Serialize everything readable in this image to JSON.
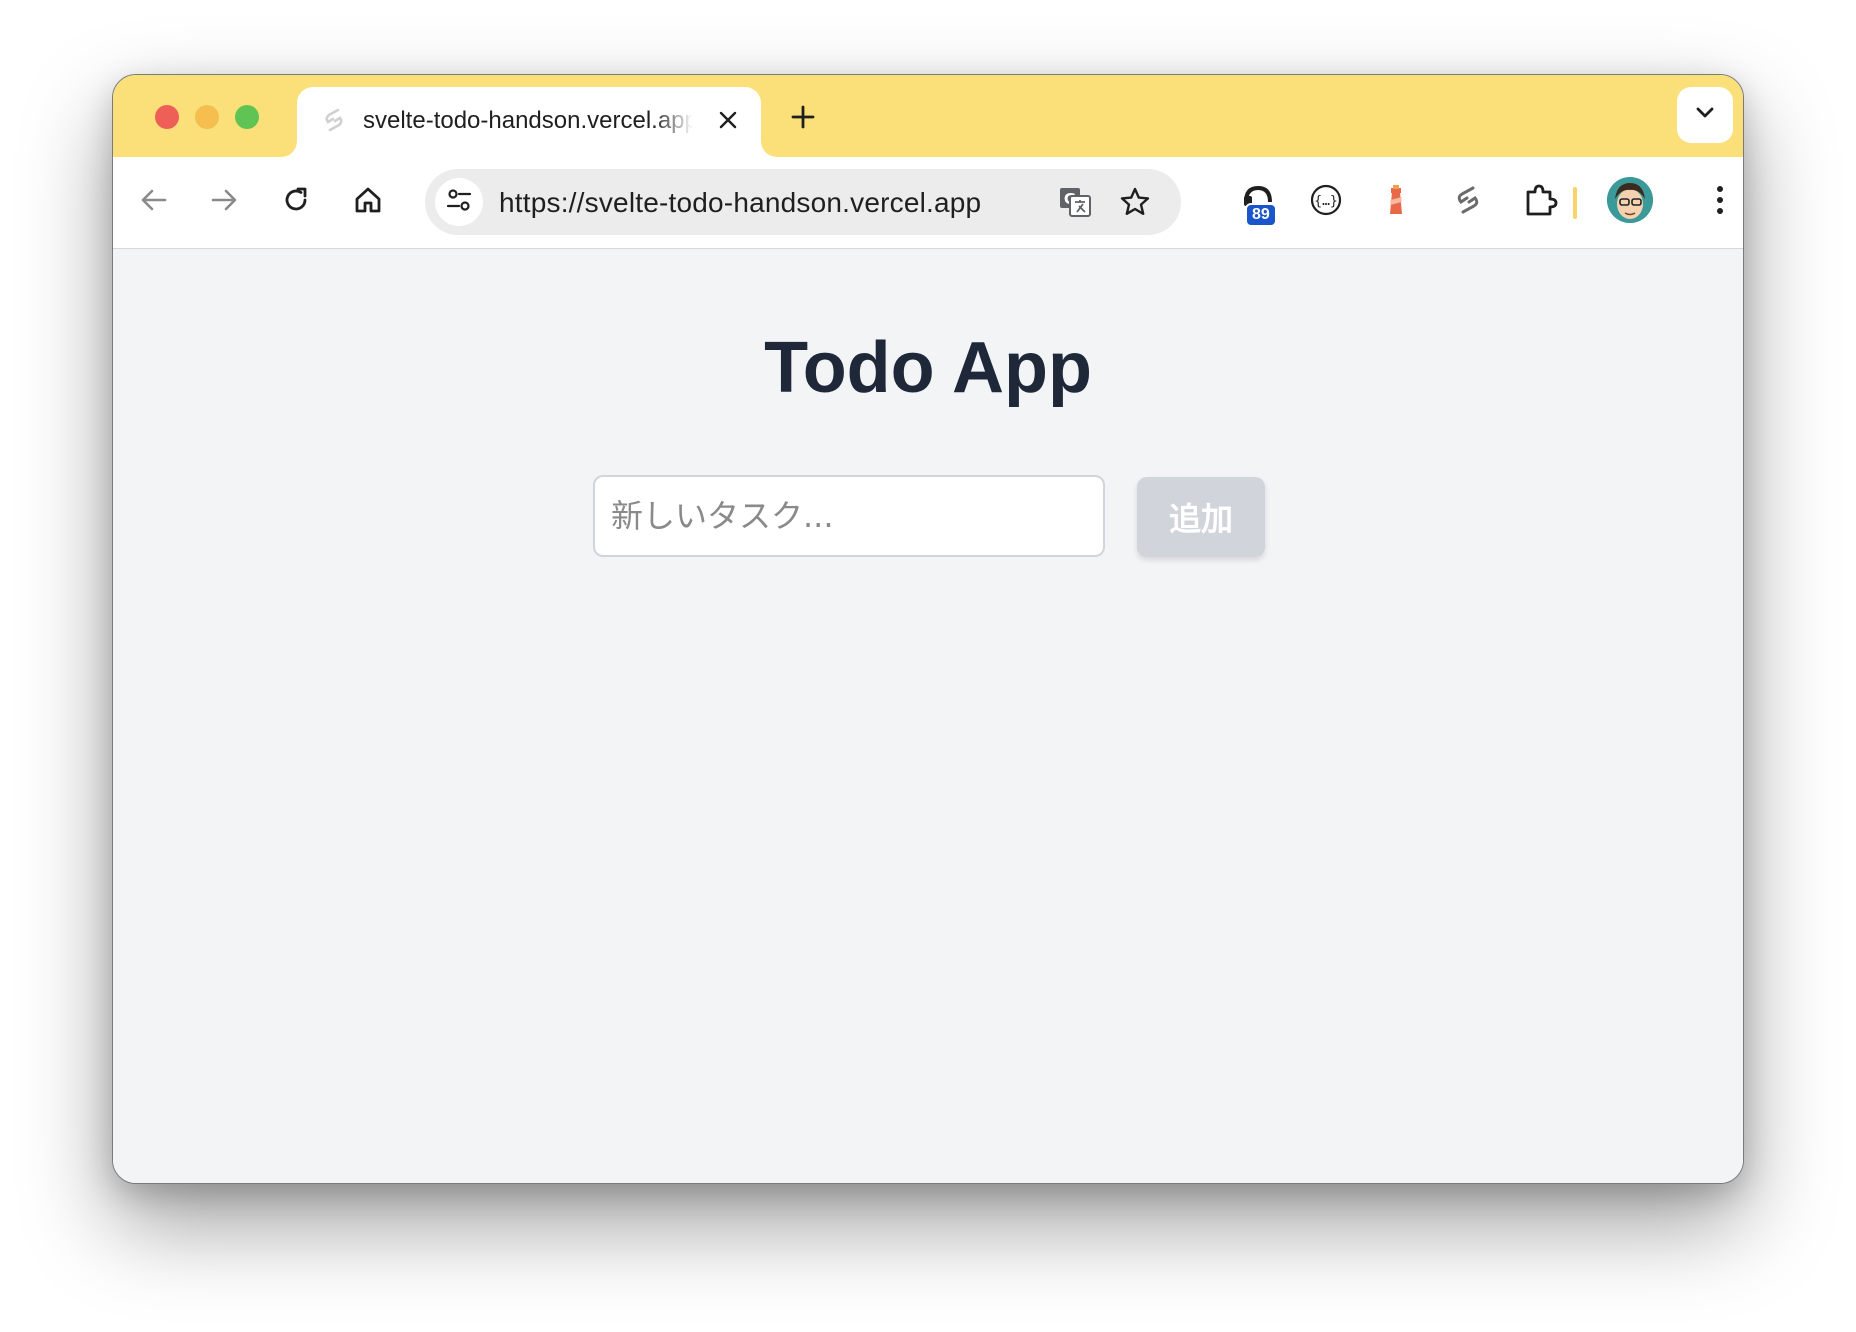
{
  "browser": {
    "tab": {
      "title": "svelte-todo-handson.vercel.app",
      "favicon": "svelte-icon"
    },
    "url": "https://svelte-todo-handson.vercel.app",
    "extensions": {
      "badge_count": "89"
    },
    "colors": {
      "tabstrip": "#fbe07a"
    }
  },
  "app": {
    "title": "Todo App",
    "input_placeholder": "新しいタスク...",
    "input_value": "",
    "add_button_label": "追加",
    "colors": {
      "title": "#1e2838",
      "background": "#f3f4f6",
      "button_disabled": "#d1d5db"
    }
  }
}
